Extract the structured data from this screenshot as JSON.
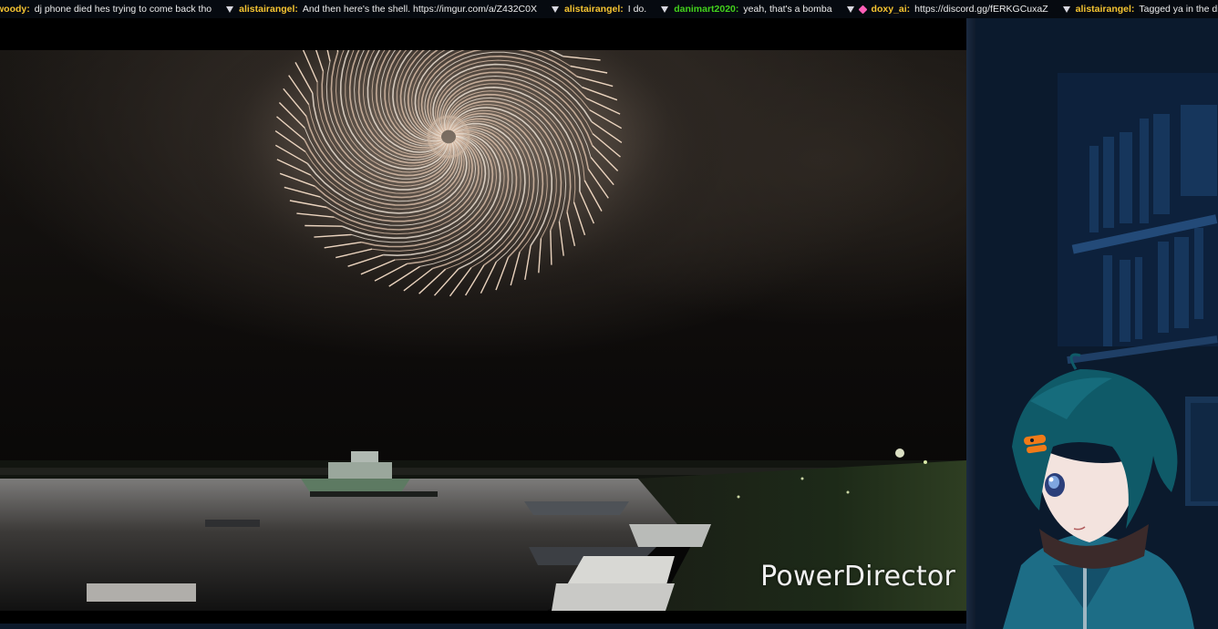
{
  "chat": {
    "messages": [
      {
        "user": "woody",
        "user_color": "#f5c431",
        "text": "dj phone died hes trying to come back tho",
        "badge": "none"
      },
      {
        "user": "alistairangel",
        "user_color": "#f5c431",
        "text": "And then here's the shell. https://imgur.com/a/Z432C0X",
        "badge": "triangle"
      },
      {
        "user": "alistairangel",
        "user_color": "#f5c431",
        "text": "I do.",
        "badge": "triangle"
      },
      {
        "user": "danimart2020",
        "user_color": "#43d11c",
        "text": "yeah, that's a bomba",
        "badge": "triangle"
      },
      {
        "user": "doxy_ai",
        "user_color": "#f5c431",
        "text": "https://discord.gg/fERKGCuxaZ",
        "badge": "triangle-gem"
      },
      {
        "user": "alistairangel",
        "user_color": "#f5c431",
        "text": "Tagged ya in the discord. :",
        "badge": "triangle"
      }
    ]
  },
  "video": {
    "watermark": "PowerDirector"
  },
  "colors": {
    "ticker_bg": "#060a10",
    "side_bg": "#0b1a2e",
    "hair": "#0f5a68",
    "hairclip": "#f07a18"
  }
}
